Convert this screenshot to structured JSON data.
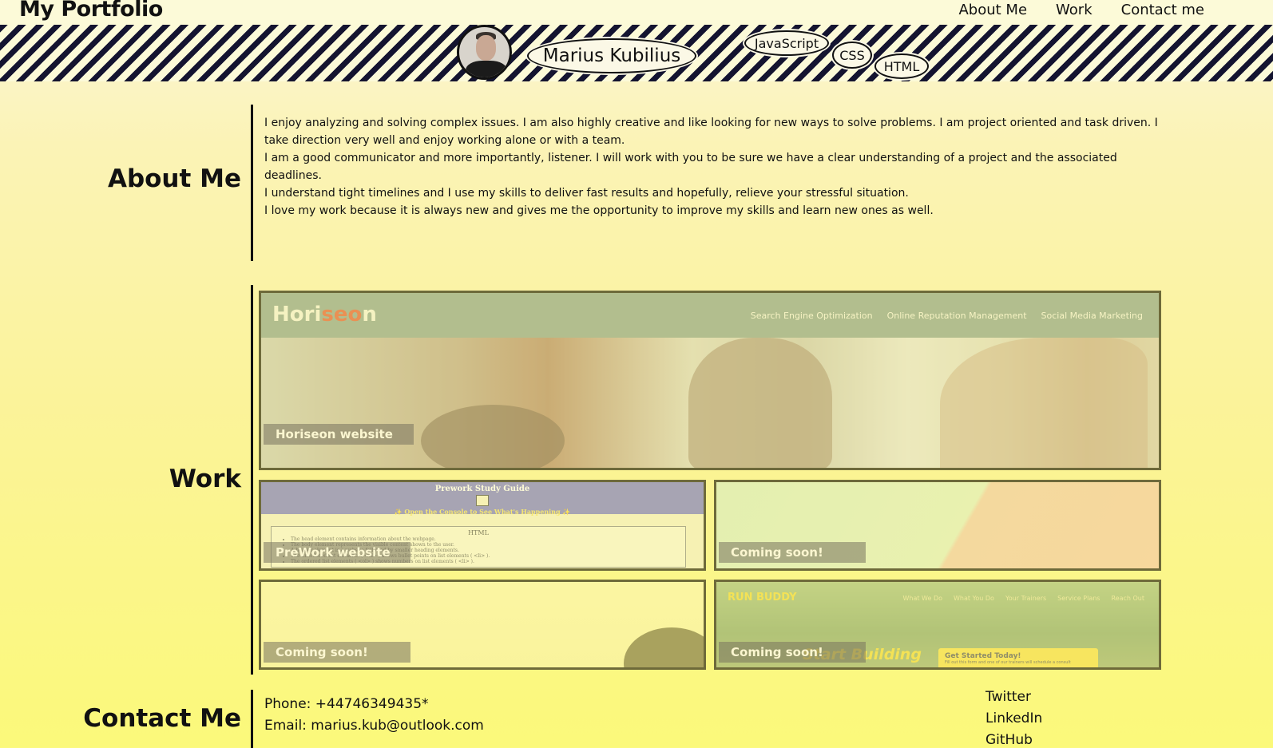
{
  "header": {
    "brand": "My Portfolio",
    "nav": [
      "About Me",
      "Work",
      "Contact me"
    ]
  },
  "hero": {
    "name": "Marius Kubilius",
    "skills": [
      "JavaScript",
      "CSS",
      "HTML"
    ]
  },
  "about": {
    "title": "About Me",
    "paragraphs": [
      "I enjoy analyzing and solving complex issues. I am also highly creative and like looking for new ways to solve problems. I am project oriented and task driven. I take direction very well and enjoy working alone or with a team.",
      "I am a good communicator and more importantly, listener. I will work with you to be sure we have a clear understanding of a project and the associated deadlines.",
      "I understand tight timelines and I use my skills to deliver fast results and hopefully, relieve your stressful situation.",
      "I love my work because it is always new and gives me the opportunity to improve my skills and learn new ones as well."
    ]
  },
  "work": {
    "title": "Work",
    "horiseon": {
      "logo_a": "Hori",
      "logo_b": "seo",
      "logo_c": "n",
      "nav": [
        "Search Engine Optimization",
        "Online Reputation Management",
        "Social Media Marketing"
      ],
      "label": "Horiseon website"
    },
    "prework": {
      "title": "Prework Study Guide",
      "subtitle": "✨ Open the Console to See What's Happening ✨",
      "section": "HTML",
      "bullets": [
        "The head element contains information about the webpage.",
        "The body element represents the visible content shown to the user.",
        "A header element is a website followed by smaller heading elements.",
        "The unordered list elements ( <ul> ) shows bullet points on list elements ( <li> ).",
        "The ordered list elements ( <ol> ) shows numbers on list elements ( <li> )."
      ],
      "label": "PreWork website"
    },
    "coming_label": "Coming soon!",
    "runbuddy": {
      "title": "RUN BUDDY",
      "nav": [
        "What We Do",
        "What You Do",
        "Your Trainers",
        "Service Plans",
        "Reach Out"
      ],
      "headline": "Start Building",
      "cta": "Get Started Today!",
      "cta_sub": "Fill out this form and one of our trainers will schedule a consult"
    }
  },
  "contact": {
    "title": "Contact Me",
    "phone": "Phone: +44746349435*",
    "email": "Email: marius.kub@outlook.com",
    "socials": [
      "Twitter",
      "LinkedIn",
      "GitHub"
    ]
  },
  "colors": {
    "stripe_dark": "#141430",
    "page_bg_top": "#fbf6d6",
    "page_bg_bottom": "#fbf97a",
    "accent_logo": "#e05a35"
  }
}
